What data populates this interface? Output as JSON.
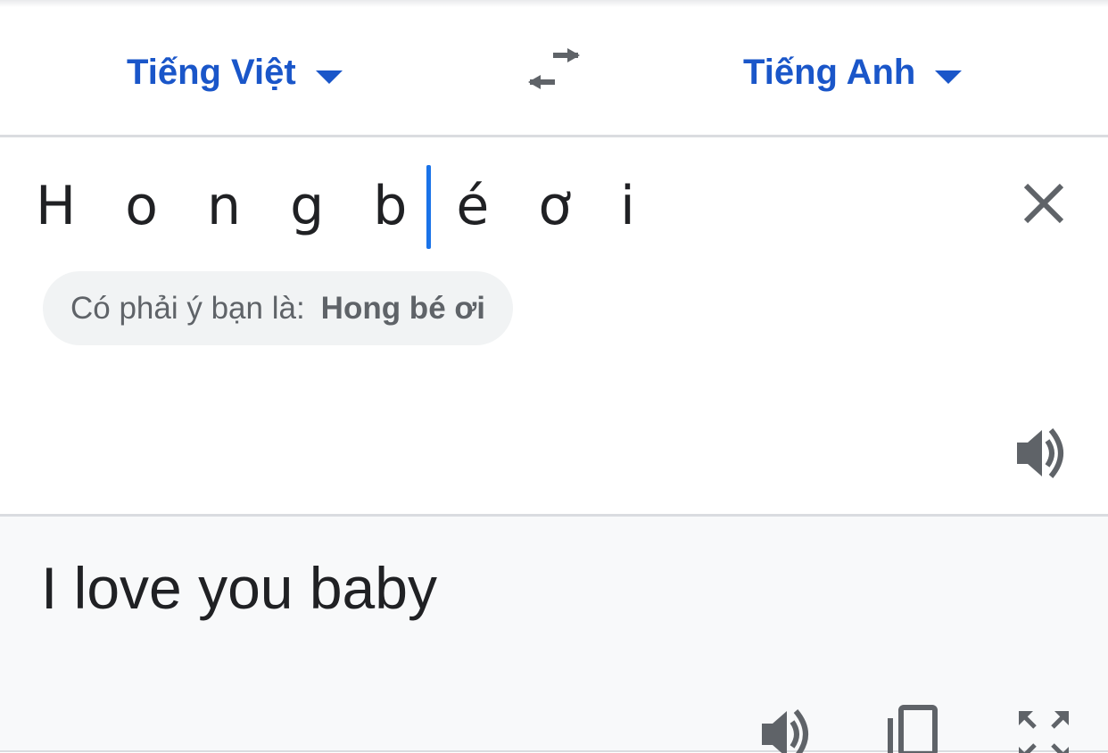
{
  "header": {
    "source_language": "Tiếng Việt",
    "target_language": "Tiếng Anh",
    "swap_icon": "swap-arrows-icon"
  },
  "input": {
    "text": "H o n g b é ơ i",
    "clear_icon": "close-icon",
    "speaker_icon": "speaker-icon"
  },
  "suggestion": {
    "prompt": "Có phải ý bạn là:",
    "text": "Hong bé ơi"
  },
  "output": {
    "translation": "I love you baby",
    "icons": [
      "speaker-icon",
      "copy-icon",
      "fullscreen-icon"
    ]
  },
  "colors": {
    "accent": "#1a56c9",
    "cursor": "#1a73e8",
    "icon_gray": "#5f6368",
    "text_dark": "#202124",
    "output_bg": "#f8f9fa",
    "divider": "#dadce0"
  }
}
